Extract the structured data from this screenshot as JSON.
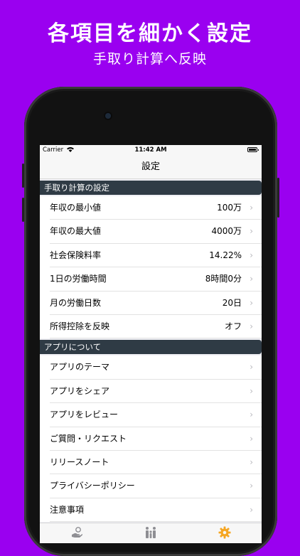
{
  "promo": {
    "headline": "各項目を細かく設定",
    "subline": "手取り計算へ反映"
  },
  "statusbar": {
    "carrier": "Carrier",
    "time": "11:42 AM"
  },
  "navbar": {
    "title": "設定"
  },
  "sections": [
    {
      "header": "手取り計算の設定",
      "rows": [
        {
          "label": "年収の最小値",
          "value": "100万"
        },
        {
          "label": "年収の最大値",
          "value": "4000万"
        },
        {
          "label": "社会保険料率",
          "value": "14.22%"
        },
        {
          "label": "1日の労働時間",
          "value": "8時間0分"
        },
        {
          "label": "月の労働日数",
          "value": "20日"
        },
        {
          "label": "所得控除を反映",
          "value": "オフ"
        }
      ]
    },
    {
      "header": "アプリについて",
      "rows": [
        {
          "label": "アプリのテーマ"
        },
        {
          "label": "アプリをシェア"
        },
        {
          "label": "アプリをレビュー"
        },
        {
          "label": "ご質問・リクエスト"
        },
        {
          "label": "リリースノート"
        },
        {
          "label": "プライバシーポリシー"
        },
        {
          "label": "注意事項"
        }
      ]
    }
  ],
  "chevron": "›",
  "tabs": [
    {
      "icon": "hand-coin-icon",
      "active": false
    },
    {
      "icon": "family-icon",
      "active": false
    },
    {
      "icon": "gear-icon",
      "active": true
    }
  ],
  "colors": {
    "background": "#9a00f0",
    "section_header": "#2f3b45",
    "tab_active": "#f5a623",
    "tab_inactive": "#8e8e93"
  }
}
